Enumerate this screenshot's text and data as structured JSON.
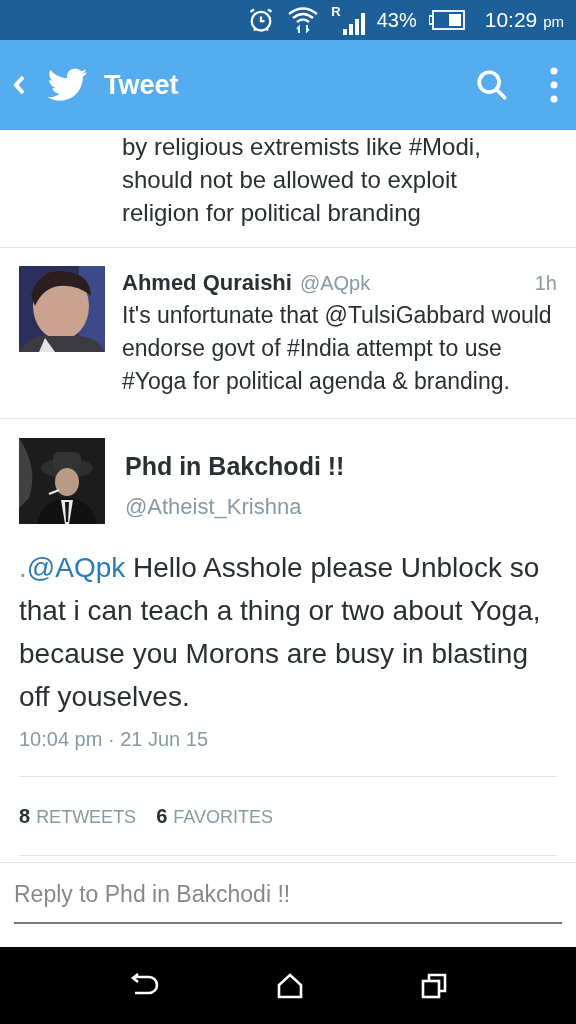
{
  "status_bar": {
    "roaming": "R",
    "battery": "43%",
    "time": "10:29",
    "period": "pm"
  },
  "app_bar": {
    "title": "Tweet"
  },
  "timeline": [
    {
      "kind": "partial",
      "lines": [
        "by religious extremists like #Modi,",
        "should not be allowed to exploit",
        "religion for political branding"
      ]
    },
    {
      "kind": "tweet",
      "name": "Ahmed Quraishi",
      "handle": "@AQpk",
      "age": "1h",
      "text": "It's unfortunate that @TulsiGabbard would endorse govt of #India attempt to use #Yoga for political agenda & branding."
    }
  ],
  "detail": {
    "name": "Phd in Bakchodi !!",
    "handle": "@Atheist_Krishna",
    "prefix": ".",
    "mention": "@AQpk",
    "text": "Hello Asshole please Unblock so that i can teach a thing or two about Yoga, because you Morons are busy in blasting off youselves.",
    "timestamp": "10:04 pm · 21 Jun 15",
    "stats": [
      {
        "count": "8",
        "label": "RETWEETS"
      },
      {
        "count": "6",
        "label": "FAVORITES"
      }
    ]
  },
  "reply": {
    "placeholder": "Reply to Phd in Bakchodi !!"
  }
}
